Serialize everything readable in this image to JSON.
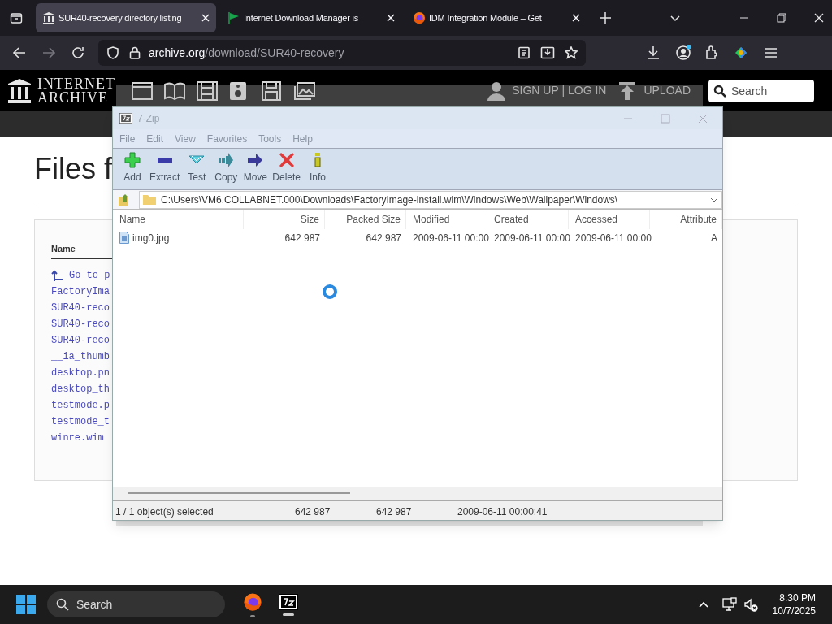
{
  "browser": {
    "tabs": [
      {
        "title": "SUR40-recovery directory listing",
        "kind": "archive",
        "selected": true
      },
      {
        "title": "Internet Download Manager is",
        "kind": "flag",
        "selected": false
      },
      {
        "title": "IDM Integration Module – Get",
        "kind": "firefox",
        "selected": false
      }
    ],
    "url": {
      "domain": "archive.org",
      "path": "/download/SUR40-recovery"
    }
  },
  "site": {
    "logo_lines": [
      "INTERNET",
      "ARCHIVE"
    ],
    "account": "SIGN UP | LOG IN",
    "upload": "UPLOAD",
    "search": {
      "placeholder": "Search"
    }
  },
  "page": {
    "heading": "Files f",
    "table": {
      "columns": [
        "Name"
      ],
      "rows": [
        {
          "name": "Go to p",
          "kind": "parent"
        },
        {
          "name": "FactoryIma",
          "kind": "file"
        },
        {
          "name": "SUR40-reco",
          "kind": "file"
        },
        {
          "name": "SUR40-reco",
          "kind": "file"
        },
        {
          "name": "SUR40-reco",
          "kind": "file"
        },
        {
          "name": "__ia_thumb",
          "kind": "file"
        },
        {
          "name": "desktop.pn",
          "kind": "file"
        },
        {
          "name": "desktop_th",
          "kind": "file"
        },
        {
          "name": "testmode.p",
          "kind": "file"
        },
        {
          "name": "testmode_t",
          "kind": "file"
        },
        {
          "name": "winre.wim",
          "kind": "file"
        }
      ]
    }
  },
  "zip_window": {
    "title": "7-Zip",
    "menu": [
      "File",
      "Edit",
      "View",
      "Favorites",
      "Tools",
      "Help"
    ],
    "toolbar": [
      {
        "label": "Add",
        "kind": "add"
      },
      {
        "label": "Extract",
        "kind": "extract"
      },
      {
        "label": "Test",
        "kind": "test"
      },
      {
        "label": "Copy",
        "kind": "copy"
      },
      {
        "label": "Move",
        "kind": "move"
      },
      {
        "label": "Delete",
        "kind": "delete"
      },
      {
        "label": "Info",
        "kind": "info"
      }
    ],
    "path": "C:\\Users\\VM6.COLLABNET.000\\Downloads\\FactoryImage-install.wim\\Windows\\Web\\Wallpaper\\Windows\\",
    "columns": [
      "Name",
      "Size",
      "Packed Size",
      "Modified",
      "Created",
      "Accessed",
      "Attribute"
    ],
    "rows": [
      {
        "cells": [
          "img0.jpg",
          "642 987",
          "642 987",
          "2009-06-11 00:00",
          "2009-06-11 00:00",
          "2009-06-11 00:00",
          "A"
        ]
      }
    ],
    "status": [
      "1 / 1 object(s) selected",
      "642 987",
      "642 987",
      "2009-06-11 00:00:41"
    ]
  },
  "taskbar": {
    "search": {
      "placeholder": "Search"
    },
    "apps": [
      {
        "kind": "firefox",
        "active": false
      },
      {
        "kind": "sevenzip",
        "active": true
      }
    ],
    "time": "8:30 PM",
    "date": "10/7/2025"
  }
}
